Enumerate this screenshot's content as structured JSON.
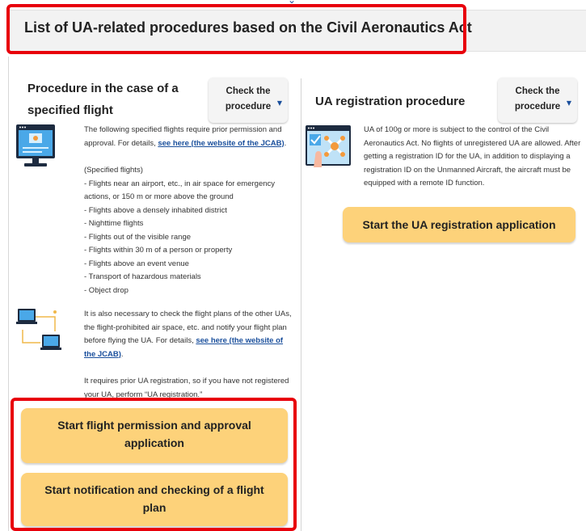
{
  "header": {
    "title": "List of UA-related procedures based on the Civil Aeronautics Act"
  },
  "specified_flight": {
    "title_line1": "Procedure in the case of a",
    "title_line2": "specified flight",
    "check_button_line1": "Check the",
    "check_button_line2": "procedure",
    "intro_text": "The following specified flights require prior permission and approval. For details,",
    "intro_link": "see here (the website of the JCAB)",
    "intro_end": ".",
    "list_heading": "(Specified flights)",
    "list_items": [
      "- Flights near an airport, etc., in air space for emergency",
      "actions, or 150 m or more above the ground",
      "- Flights above a densely inhabited district",
      "- Nighttime flights",
      "- Flights out of the visible range",
      "- Flights within 30 m of a person or property",
      "- Flights above an event venue",
      "- Transport of hazardous materials",
      "- Object drop"
    ],
    "plans_text": "It is also necessary to check the flight plans of the other UAs, the flight-prohibited air space, etc. and notify your flight plan before flying the UA. For details,",
    "plans_link": "see here (the website of the JCAB)",
    "plans_end": ".",
    "registration_note": "It requires prior UA registration, so if you have not registered your UA, perform “UA registration.”",
    "button_permission": "Start flight permission and approval application",
    "button_notification": "Start notification and checking of a flight plan"
  },
  "ua_registration": {
    "title": "UA registration procedure",
    "check_button_line1": "Check the",
    "check_button_line2": "procedure",
    "text": "UA of 100g or more is subject to the control of the Civil Aeronautics Act. No flights of unregistered UA are allowed. After getting a registration ID for the UA, in addition to displaying a registration ID on the Unmanned Aircraft, the aircraft must be equipped with a remote ID function.",
    "button_start": "Start the UA registration application"
  },
  "colors": {
    "highlight_red": "#e8000b",
    "button_yellow": "#fdd27a",
    "link_blue": "#1a4f9c"
  },
  "icons": [
    "chevron-down-icon",
    "monitor-drone-icon",
    "network-computers-icon",
    "drone-registration-icon",
    "caret-down-icon"
  ]
}
